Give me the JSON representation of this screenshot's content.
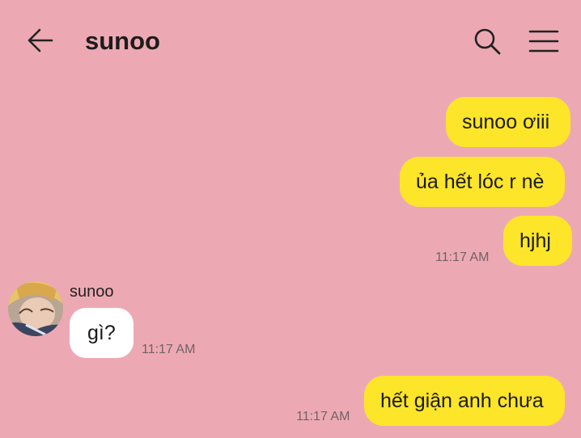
{
  "header": {
    "title": "sunoo",
    "back_icon": "arrow-left-icon",
    "search_icon": "search-icon",
    "menu_icon": "hamburger-menu-icon"
  },
  "messages": [
    {
      "text": "sunoo ơiii",
      "direction": "outgoing"
    },
    {
      "text": "ủa hết lóc r nè",
      "direction": "outgoing"
    },
    {
      "text": "hjhj",
      "direction": "outgoing",
      "time": "11:17 AM"
    },
    {
      "sender": "sunoo",
      "text": "gì?",
      "direction": "incoming",
      "time": "11:17 AM"
    },
    {
      "text": "hết giận anh chưa",
      "direction": "outgoing",
      "time": "11:17 AM"
    }
  ],
  "colors": {
    "background": "#eda9b3",
    "outgoing_bubble": "#fde52a",
    "incoming_bubble": "#ffffff"
  }
}
